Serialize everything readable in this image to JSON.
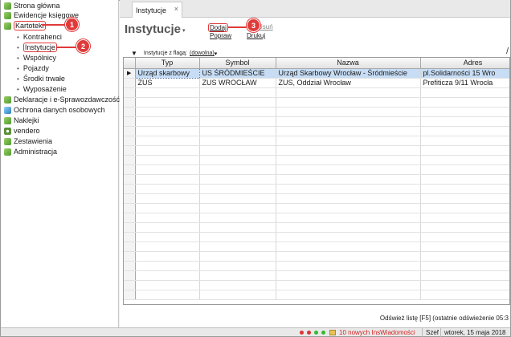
{
  "sidebar": {
    "items": [
      {
        "label": "Strona główna",
        "icon": "home-icon"
      },
      {
        "label": "Ewidencje księgowe",
        "icon": "ledger-icon"
      },
      {
        "label": "Kartoteki",
        "icon": "folder-icon"
      },
      {
        "label": "Deklaracje i e-Sprawozdawczość",
        "icon": "declaration-icon"
      },
      {
        "label": "Ochrona danych osobowych",
        "icon": "data-protection-icon"
      },
      {
        "label": "Naklejki",
        "icon": "sticker-icon"
      },
      {
        "label": "vendero",
        "icon": "gear-icon"
      },
      {
        "label": "Zestawienia",
        "icon": "report-icon"
      },
      {
        "label": "Administracja",
        "icon": "admin-icon"
      }
    ],
    "kartoteki_sub": [
      "Kontrahenci",
      "Instytucje",
      "Wspólnicy",
      "Pojazdy",
      "Środki trwałe",
      "Wyposażenie"
    ]
  },
  "tab": {
    "label": "Instytucje",
    "close": "×"
  },
  "page": {
    "title": "Instytucje",
    "title_caret": "▾"
  },
  "actions": {
    "add": "Dodaj",
    "edit": "Popraw",
    "delete": "Usuń",
    "print": "Drukuj"
  },
  "filter": {
    "label": "Instytucje z flagą:",
    "value": "(dowolna)",
    "caret": "▾",
    "toggle": "▼"
  },
  "grid": {
    "columns": [
      "Typ",
      "Symbol",
      "Nazwa",
      "Adres"
    ],
    "rows": [
      {
        "marker": "▶",
        "typ": "Urząd skarbowy",
        "symbol": "US ŚRÓDMIEŚCIE",
        "nazwa": "Urząd Skarbowy Wrocław - Śródmieście",
        "adres": "pl.Solidarności 15 Wro"
      },
      {
        "marker": "",
        "typ": "ZUS",
        "symbol": "ZUS WROCŁAW",
        "nazwa": "ZUS, Oddział Wrocław",
        "adres": "Prefiticza 9/11 Wrocła"
      }
    ],
    "selected_row": 0
  },
  "footer": {
    "refresh": "Odśwież listę [F5] (ostatnie odświeżenie 05:3"
  },
  "callouts": [
    "1",
    "2",
    "3"
  ],
  "statusbar": {
    "notifications": "10 nowych InsWiadomości",
    "user": "Szef",
    "date": "wtorek, 15 maja 2018"
  },
  "colors": {
    "accent_red": "#e03a3a",
    "selection": "#c7ddf5"
  }
}
